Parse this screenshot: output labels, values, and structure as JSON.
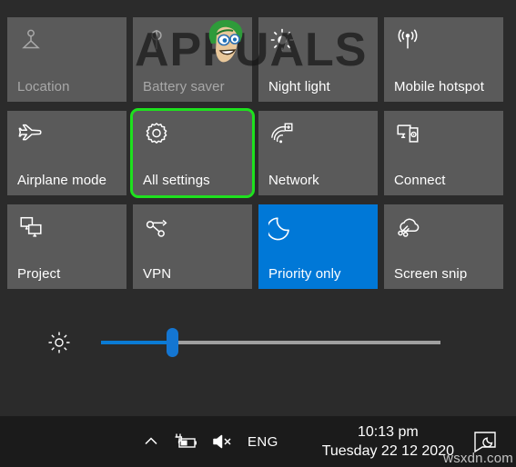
{
  "window": {
    "name": "windows-action-center",
    "background_color": "#2b2b2b",
    "tile_color": "#5a5a5a",
    "tile_active_color": "#0078d7",
    "highlight_color": "#1ee11e"
  },
  "quick_actions": {
    "tiles": [
      {
        "id": "location",
        "label": "Location",
        "icon": "location-pin-icon",
        "state": "dim",
        "highlighted": false
      },
      {
        "id": "battery-saver",
        "label": "Battery saver",
        "icon": "leaf-icon",
        "state": "dim",
        "highlighted": false
      },
      {
        "id": "night-light",
        "label": "Night light",
        "icon": "sun-icon",
        "state": "off",
        "highlighted": false
      },
      {
        "id": "mobile-hotspot",
        "label": "Mobile hotspot",
        "icon": "hotspot-icon",
        "state": "off",
        "highlighted": false
      },
      {
        "id": "airplane-mode",
        "label": "Airplane mode",
        "icon": "airplane-icon",
        "state": "off",
        "highlighted": false
      },
      {
        "id": "all-settings",
        "label": "All settings",
        "icon": "gear-icon",
        "state": "off",
        "highlighted": true
      },
      {
        "id": "network",
        "label": "Network",
        "icon": "wifi-network-icon",
        "state": "off",
        "highlighted": false
      },
      {
        "id": "connect",
        "label": "Connect",
        "icon": "connect-display-icon",
        "state": "off",
        "highlighted": false
      },
      {
        "id": "project",
        "label": "Project",
        "icon": "project-screen-icon",
        "state": "off",
        "highlighted": false
      },
      {
        "id": "vpn",
        "label": "VPN",
        "icon": "vpn-icon",
        "state": "off",
        "highlighted": false
      },
      {
        "id": "priority-only",
        "label": "Priority only",
        "icon": "moon-icon",
        "state": "on",
        "highlighted": false
      },
      {
        "id": "screen-snip",
        "label": "Screen snip",
        "icon": "scissors-cloud-icon",
        "state": "off",
        "highlighted": false
      }
    ]
  },
  "brightness": {
    "icon": "brightness-sun-icon",
    "value_percent": 21,
    "track_color": "#a0a0a0",
    "fill_color": "#0a7bd4"
  },
  "taskbar": {
    "tray": {
      "show_hidden_icons": "show-hidden-icons-chevron-icon",
      "battery": "battery-charging-icon",
      "volume": "volume-muted-icon",
      "language": "ENG"
    },
    "clock": {
      "time": "10:13 pm",
      "date": "Tuesday 22 12 2020"
    },
    "action_center": "action-center-icon"
  },
  "watermarks": {
    "brand": "APPUALS",
    "site": "wsxdn.com"
  }
}
